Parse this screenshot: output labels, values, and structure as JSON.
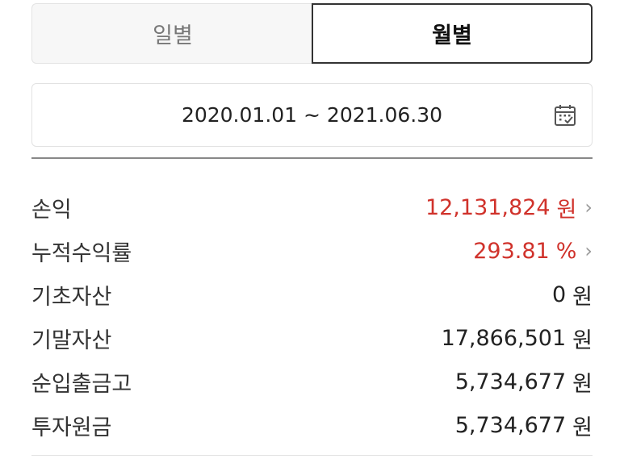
{
  "tabs": {
    "daily": "일별",
    "monthly": "월별"
  },
  "date_range": "2020.01.01 ~ 2021.06.30",
  "icons": {
    "calendar": "calendar-icon",
    "chevron": "chevron-right-icon"
  },
  "colors": {
    "profit_red": "#d0322b"
  },
  "rows": [
    {
      "label": "손익",
      "value": "12,131,824",
      "unit": "원",
      "chevron": "›"
    },
    {
      "label": "누적수익률",
      "value": "293.81",
      "unit": "%",
      "chevron": "›"
    },
    {
      "label": "기초자산",
      "value": "0",
      "unit": "원"
    },
    {
      "label": "기말자산",
      "value": "17,866,501",
      "unit": "원"
    },
    {
      "label": "순입출금고",
      "value": "5,734,677",
      "unit": "원"
    },
    {
      "label": "투자원금",
      "value": "5,734,677",
      "unit": "원"
    }
  ]
}
